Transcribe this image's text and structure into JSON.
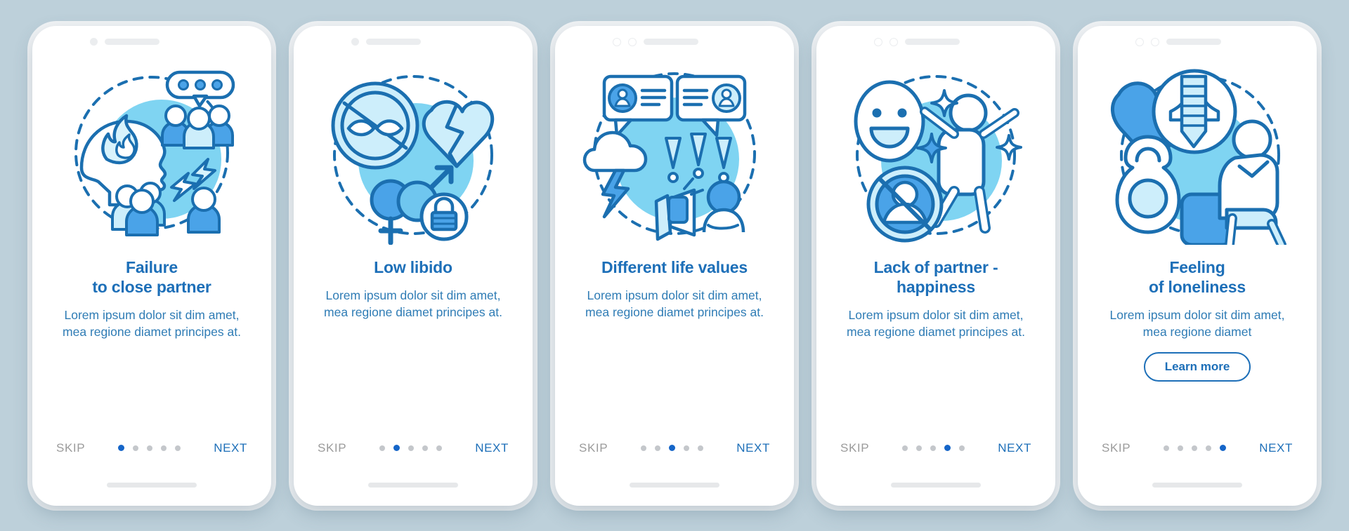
{
  "background_color": "#bdd0da",
  "theme": {
    "accent": "#1d6fb8",
    "title_color": "#1d6fb8",
    "body_color": "#2f7cb5",
    "dot_active": "#1565c8",
    "dot_inactive": "#c4c7cb",
    "skip_color": "#9b9b9b",
    "blob_color": "#7fd4f2",
    "line_color": "#1b6fb0"
  },
  "common": {
    "skip_label": "SKIP",
    "next_label": "NEXT",
    "body_text": "Lorem ipsum dolor sit dim amet, mea regione diamet principes at.",
    "dot_count": 5
  },
  "screens": [
    {
      "id": "failure-to-close-partner",
      "notch_style": "single-dot",
      "title": "Failure\nto close partner",
      "title_line1": "Failure",
      "title_line2": "to close partner",
      "body": "Lorem ipsum dolor sit dim amet, mea regione diamet principes at.",
      "active_dot": 1,
      "skip_label": "SKIP",
      "next_label": "NEXT",
      "illustration_name": "angry-head-flame-crowd-illustration",
      "cta": null
    },
    {
      "id": "low-libido",
      "notch_style": "single-dot",
      "title": "Low libido",
      "title_line1": "Low libido",
      "title_line2": "",
      "body": "Lorem ipsum dolor sit dim amet, mea regione diamet principes at.",
      "active_dot": 2,
      "skip_label": "SKIP",
      "next_label": "NEXT",
      "illustration_name": "no-intimacy-broken-heart-gender-lock-illustration",
      "cta": null
    },
    {
      "id": "different-life-values",
      "notch_style": "double-ring",
      "title": "Different life values",
      "title_line1": "Different life values",
      "title_line2": "",
      "body": "Lorem ipsum dolor sit dim amet, mea regione diamet principes at.",
      "active_dot": 3,
      "skip_label": "SKIP",
      "next_label": "NEXT",
      "illustration_name": "argument-speech-bubbles-storm-megaphone-illustration",
      "cta": null
    },
    {
      "id": "lack-of-partner-happiness",
      "notch_style": "double-ring",
      "title": "Lack of partner - happiness",
      "title_line1": "Lack of partner -",
      "title_line2": "happiness",
      "body": "Lorem ipsum dolor sit dim amet, mea regione diamet principes at.",
      "active_dot": 4,
      "skip_label": "SKIP",
      "next_label": "NEXT",
      "illustration_name": "smiley-jumping-person-no-partner-illustration",
      "cta": null
    },
    {
      "id": "feeling-of-loneliness",
      "notch_style": "double-ring",
      "title": "Feeling\nof loneliness",
      "title_line1": "Feeling",
      "title_line2": "of loneliness",
      "body": "Lorem ipsum dolor sit dim amet, mea regione diamet",
      "active_dot": 5,
      "skip_label": "SKIP",
      "next_label": "NEXT",
      "illustration_name": "heart-screw-kettlebell-sad-person-illustration",
      "cta": "Learn more"
    }
  ]
}
